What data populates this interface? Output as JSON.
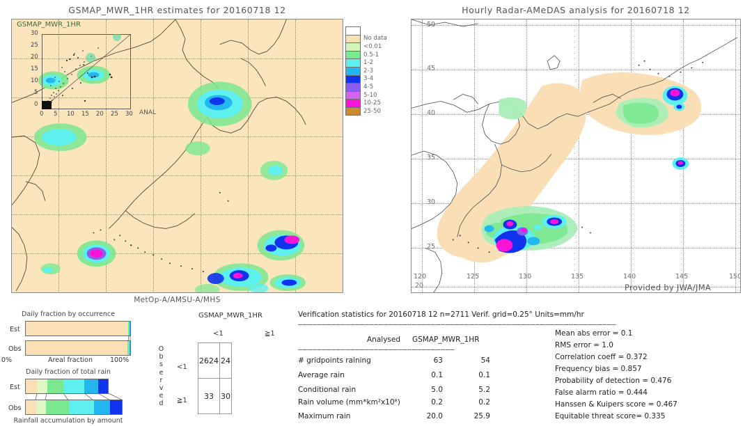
{
  "left_panel": {
    "title": "GSMAP_MWR_1HR estimates for 20160718 12",
    "overlay_label": "GSMAP_MWR_1HR",
    "caption": "MetOp-A/AMSU-A/MHS",
    "inset": {
      "x_label": "ANAL",
      "ticks": [
        "0",
        "5",
        "10",
        "15",
        "20",
        "25",
        "30"
      ],
      "y_ticks": [
        "0",
        "5",
        "10",
        "15",
        "20",
        "25",
        "30"
      ]
    }
  },
  "right_panel": {
    "title": "Hourly Radar-AMeDAS analysis for 20160718 12",
    "credit": "Provided by JWA/JMA",
    "lon_ticks": [
      "120",
      "125",
      "130",
      "135",
      "140",
      "145",
      "150"
    ],
    "lat_ticks": [
      "20",
      "25",
      "30",
      "35",
      "40",
      "45",
      "50"
    ],
    "corner_label": "20"
  },
  "legend": {
    "entries": [
      {
        "label": "",
        "color": "#ffffff"
      },
      {
        "label": "No data",
        "color": "#fae0b4"
      },
      {
        "label": "<0.01",
        "color": "#d4f3b8"
      },
      {
        "label": "0.5-1",
        "color": "#7ae88f"
      },
      {
        "label": "1-2",
        "color": "#5ef0ef"
      },
      {
        "label": "2-3",
        "color": "#23b6ef"
      },
      {
        "label": "3-4",
        "color": "#1133ee"
      },
      {
        "label": "4-5",
        "color": "#8a5cf0"
      },
      {
        "label": "5-10",
        "color": "#d264ee"
      },
      {
        "label": "10-25",
        "color": "#ff12d8"
      },
      {
        "label": "25-50",
        "color": "#cc8a33"
      }
    ]
  },
  "occurrence_chart": {
    "title": "Daily fraction by occurrence",
    "row_labels": [
      "Est",
      "Obs"
    ],
    "axis_left": "0%",
    "axis_center": "Areal fraction",
    "axis_right": "100%",
    "est_segments": [
      {
        "color": "#fae0b4",
        "pct": 97.8
      },
      {
        "color": "#7ae88f",
        "pct": 1.4
      },
      {
        "color": "#5ef0ef",
        "pct": 0.4
      },
      {
        "color": "#23b6ef",
        "pct": 0.4
      }
    ],
    "obs_segments": [
      {
        "color": "#fae0b4",
        "pct": 97.6
      },
      {
        "color": "#7ae88f",
        "pct": 1.5
      },
      {
        "color": "#5ef0ef",
        "pct": 0.5
      },
      {
        "color": "#23b6ef",
        "pct": 0.4
      }
    ]
  },
  "amount_chart": {
    "title": "Daily fraction of total rain",
    "footer": "Rainfall accumulation by amount",
    "row_labels": [
      "Est",
      "Obs"
    ],
    "est_segments": [
      {
        "color": "#fae0b4",
        "pct": 14
      },
      {
        "color": "#e2f7c6",
        "pct": 9
      },
      {
        "color": "#7ae88f",
        "pct": 17
      },
      {
        "color": "#5ef0ef",
        "pct": 22
      },
      {
        "color": "#23b6ef",
        "pct": 16
      },
      {
        "color": "#1133ee",
        "pct": 12
      }
    ],
    "obs_segments": [
      {
        "color": "#fae0b4",
        "pct": 10
      },
      {
        "color": "#e2f7c6",
        "pct": 9
      },
      {
        "color": "#7ae88f",
        "pct": 22
      },
      {
        "color": "#5ef0ef",
        "pct": 24
      },
      {
        "color": "#23b6ef",
        "pct": 15
      },
      {
        "color": "#1133ee",
        "pct": 11
      }
    ]
  },
  "contingency": {
    "header": "GSMAP_MWR_1HR",
    "col_labels": [
      "<1",
      "≧1"
    ],
    "row_labels": [
      "<1",
      "≧1"
    ],
    "side_label": "Observed",
    "cells": [
      [
        "2624",
        "24"
      ],
      [
        "33",
        "30"
      ]
    ]
  },
  "verification": {
    "header": "Verification statistics for 20160718 12  n=2711  Verif. grid=0.25°  Units=mm/hr",
    "divider": "———————————————————————————————————————————————————————————————————",
    "col_headers": [
      "Analysed",
      "GSMAP_MWR_1HR"
    ],
    "sub_divider": "—————————————————————————————————",
    "rows": [
      {
        "label": "# gridpoints raining",
        "analysed": "63",
        "model": "54"
      },
      {
        "label": "Average rain",
        "analysed": "0.1",
        "model": "0.1"
      },
      {
        "label": "Conditional rain",
        "analysed": "5.0",
        "model": "5.2"
      },
      {
        "label": "Rain volume (mm*km²x10⁸)",
        "analysed": "0.2",
        "model": "0.2"
      },
      {
        "label": "Maximum rain",
        "analysed": "20.0",
        "model": "25.9"
      }
    ],
    "scores": [
      "Mean abs error = 0.1",
      "RMS error = 1.0",
      "Correlation coeff = 0.372",
      "Frequency bias = 0.857",
      "Probability of detection = 0.476",
      "False alarm ratio = 0.444",
      "Hanssen & Kuipers score = 0.467",
      "Equitable threat score= 0.335"
    ]
  }
}
